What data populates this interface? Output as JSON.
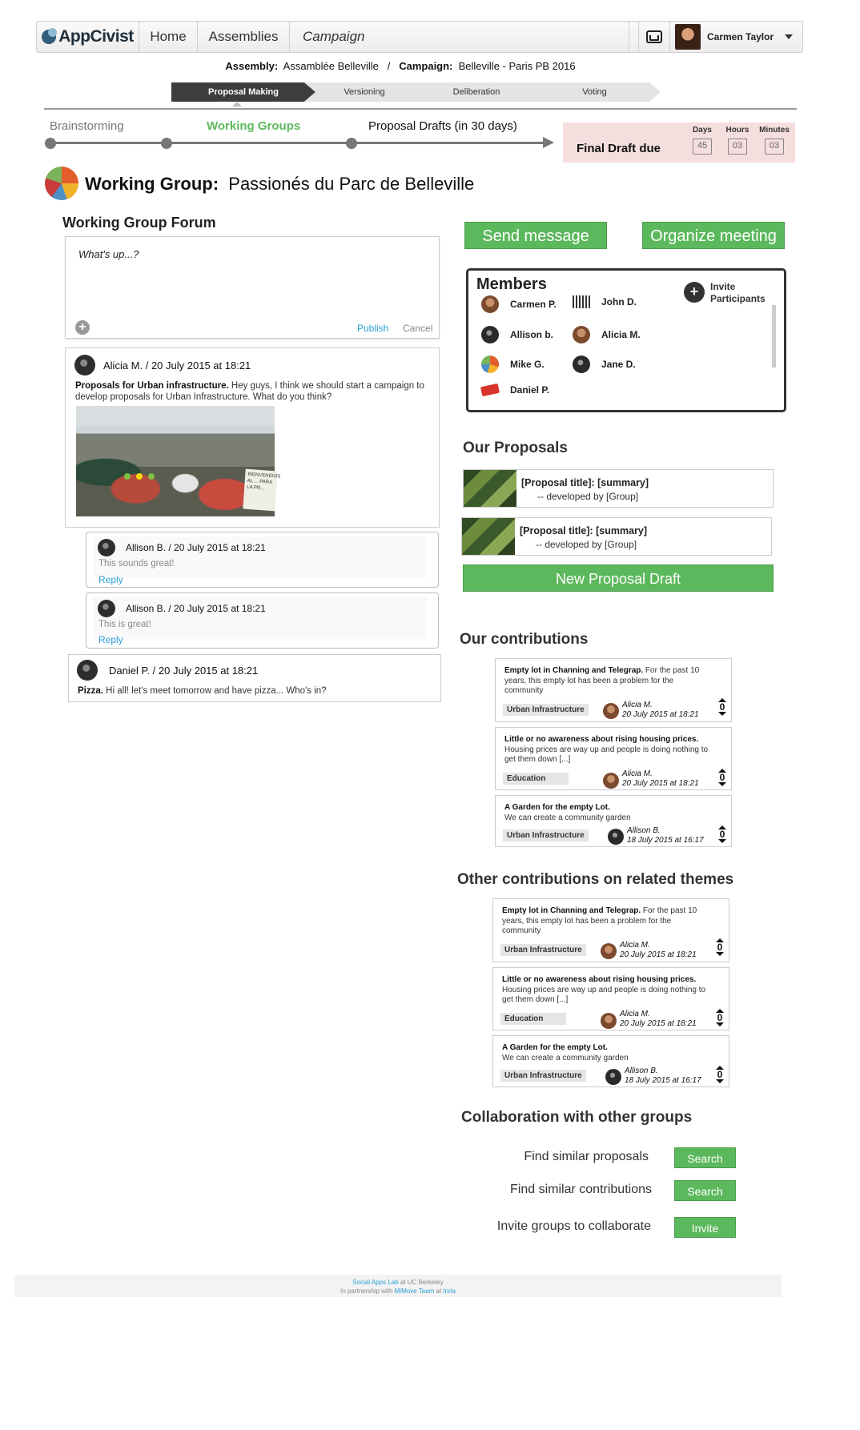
{
  "nav": {
    "logo_text": "AppCivist",
    "home": "Home",
    "assemblies": "Assemblies",
    "campaign": "Campaign",
    "user_name": "Carmen Taylor"
  },
  "context": {
    "assembly_label": "Assembly:",
    "assembly_value": "Assamblée Belleville",
    "separator": "/",
    "campaign_label": "Campaign:",
    "campaign_value": "Belleville - Paris PB 2016"
  },
  "phases": [
    {
      "label": "Proposal Making",
      "active": true
    },
    {
      "label": "Versioning",
      "active": false
    },
    {
      "label": "Deliberation",
      "active": false
    },
    {
      "label": "Voting",
      "active": false
    }
  ],
  "timeline": {
    "stages": [
      "Brainstorming",
      "Working Groups",
      "Proposal Drafts (in 30 days)"
    ],
    "current": "Working Groups",
    "due_label": "Final Draft due",
    "countdown": [
      {
        "unit": "Days",
        "value": "45"
      },
      {
        "unit": "Hours",
        "value": "03"
      },
      {
        "unit": "Minutes",
        "value": "03"
      }
    ]
  },
  "working_group": {
    "label": "Working Group:",
    "name": "Passionés du Parc de Belleville"
  },
  "forum": {
    "title": "Working Group Forum",
    "composer_placeholder": "What's up...?",
    "publish": "Publish",
    "cancel": "Cancel",
    "posts": [
      {
        "header": "Alicia M. /  20 July 2015 at 18:21",
        "title": "Proposals for Urban infrastructure.",
        "body": " Hey guys, I think we should start a campaign to develop proposals for Urban Infrastructure. What do you think?",
        "photo_banner": "BIENVENIDOS AL ... PARA LA PR..."
      },
      {
        "header": "Allison B. /  20 July 2015 at 18:21",
        "body": "This sounds great!",
        "reply": "Reply"
      },
      {
        "header": "Allison B. /  20 July 2015 at 18:21",
        "body": "This is great!",
        "reply": "Reply"
      },
      {
        "header": "Daniel P. /  20 July 2015 at 18:21",
        "title": "Pizza.",
        "body": " Hi all! let's meet tomorrow and have pizza... Who's in?"
      }
    ]
  },
  "actions": {
    "send_message": "Send message",
    "organize_meeting": "Organize meeting"
  },
  "members": {
    "title": "Members",
    "invite": "Invite Participants",
    "list": [
      "Carmen P.",
      "John D.",
      "Allison b.",
      "Alicia M.",
      "Mike G.",
      "Jane D.",
      "Daniel P."
    ]
  },
  "proposals": {
    "title": "Our Proposals",
    "items": [
      {
        "title": "[Proposal title]: [summary]",
        "by": "-- developed by [Group]"
      },
      {
        "title": "[Proposal title]: [summary]",
        "by": "-- developed by [Group]"
      }
    ],
    "new_draft": "New Proposal Draft"
  },
  "contributions": {
    "title": "Our contributions",
    "items": [
      {
        "title": "Empty lot in Channing and Telegrap.",
        "text": " For the past 10 years, this empty lot has been a problem for the community",
        "tag": "Urban Infrastructure",
        "author": "Alicia M.",
        "date": "20 July 2015 at 18:21",
        "votes": "0"
      },
      {
        "title": "Little or no awareness about rising housing prices.",
        "text": " Housing prices are way up and people is doing nothing to get them down [...]",
        "tag": "Education",
        "author": "Alicia M.",
        "date": "20 July 2015 at 18:21",
        "votes": "0"
      },
      {
        "title": "A Garden for the empty Lot.",
        "text": " We can create a community garden",
        "tag": "Urban Infrastructure",
        "author": "Allison B.",
        "date": "18 July 2015 at 16:17",
        "votes": "0"
      }
    ]
  },
  "related": {
    "title": "Other contributions on related themes",
    "items": [
      {
        "title": "Empty lot in Channing and Telegrap.",
        "text": " For the past 10 years, this empty lot has been a problem for the community",
        "tag": "Urban Infrastructure",
        "author": "Alicia M.",
        "date": "20 July 2015 at 18:21",
        "votes": "0"
      },
      {
        "title": "Little or no awareness about rising housing prices.",
        "text": " Housing prices are way up and people is doing nothing to get them down [...]",
        "tag": "Education",
        "author": "Alicia M.",
        "date": "20 July 2015 at 18:21",
        "votes": "0"
      },
      {
        "title": "A Garden for the empty Lot.",
        "text": " We can create a community garden",
        "tag": "Urban Infrastructure",
        "author": "Allison B.",
        "date": "18 July 2015 at 16:17",
        "votes": "0"
      }
    ]
  },
  "collaboration": {
    "title": "Collaboration with other groups",
    "rows": [
      {
        "label": "Find similar proposals",
        "button": "Search"
      },
      {
        "label": "Find similar contributions",
        "button": "Search"
      },
      {
        "label": "Invite groups to collaborate",
        "button": "Invite"
      }
    ]
  },
  "footer": {
    "lab": "Social Apps Lab",
    "at1": " at UC Berkeley",
    "partner_prefix": "In partnership with ",
    "team": "MiMove Team",
    "at2": " at ",
    "inria": "Inria"
  },
  "colors": {
    "accent_green": "#5cb85c",
    "link_blue": "#2a9fd6",
    "due_background": "#f5dede",
    "active_phase": "#3d3d3d"
  },
  "icons": [
    "inbox-icon",
    "caret-down-icon",
    "plus-icon",
    "avatar-icon"
  ]
}
